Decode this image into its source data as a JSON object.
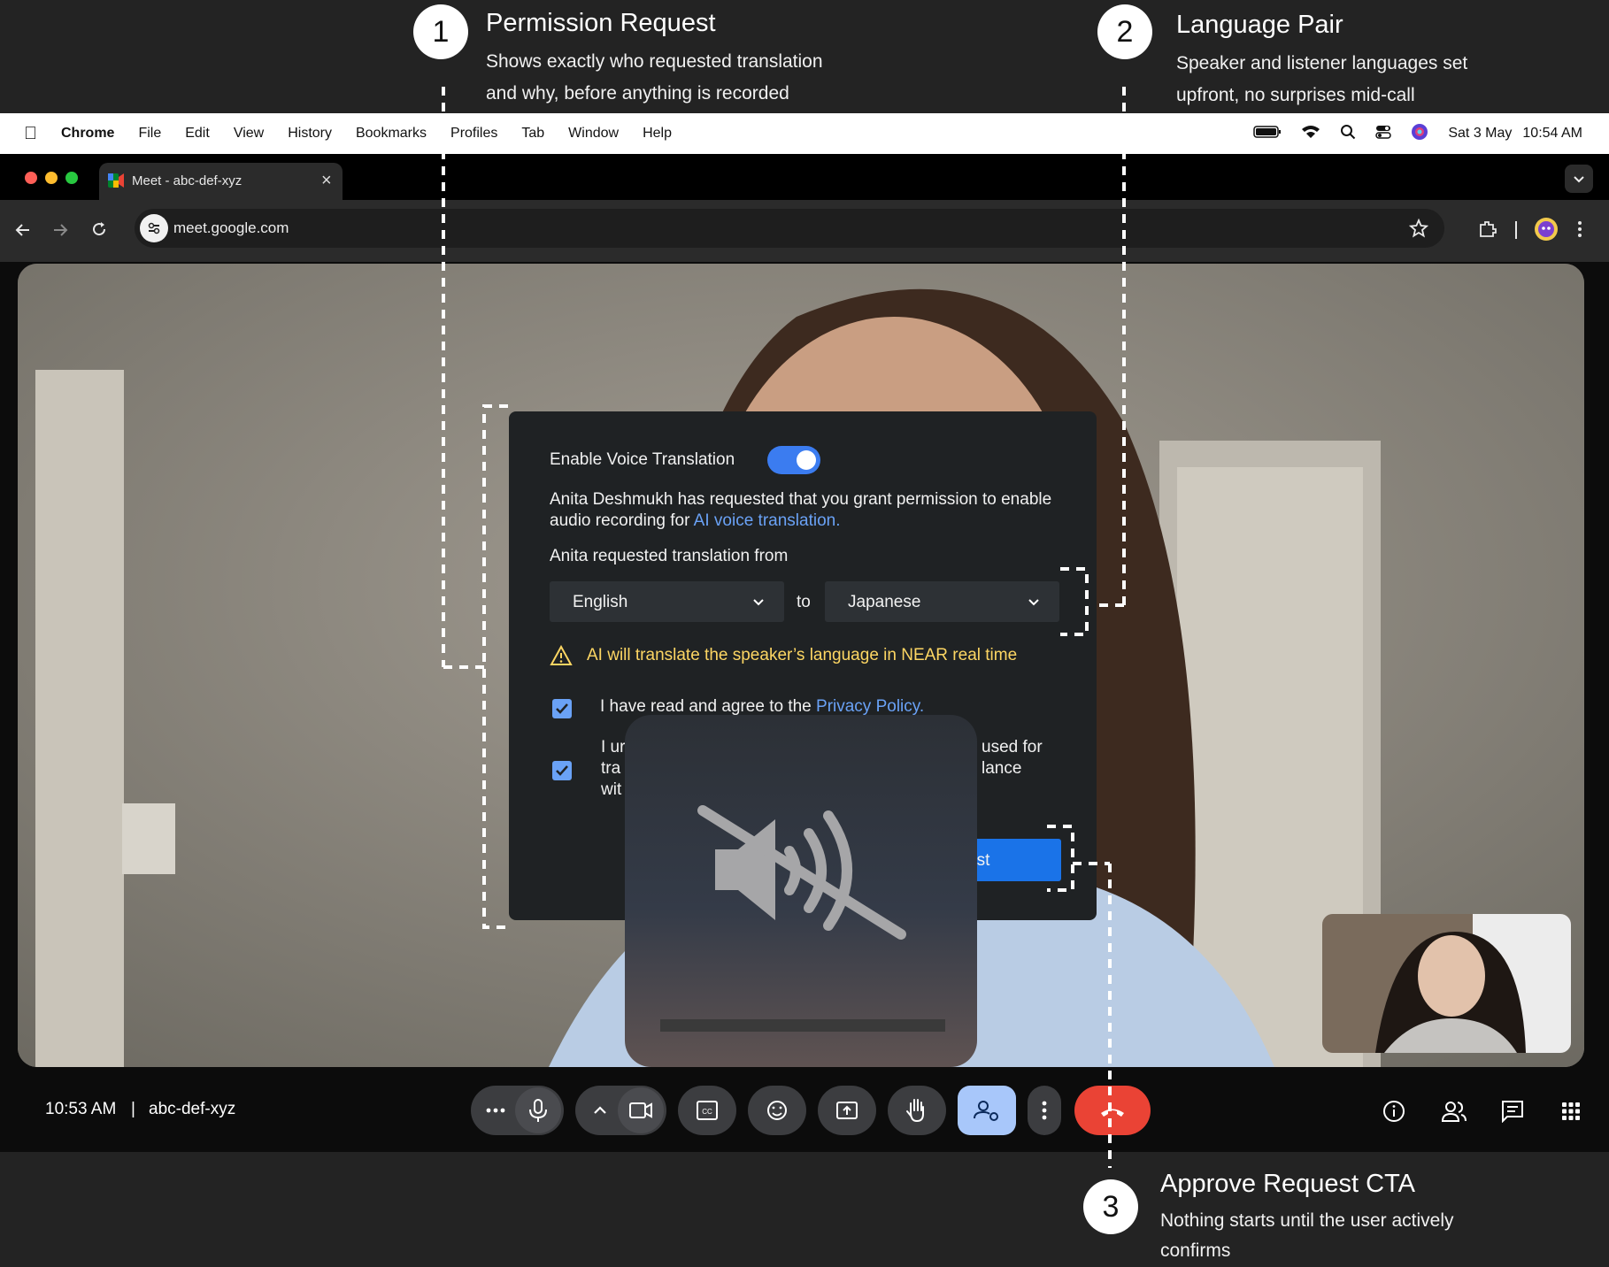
{
  "annotations": [
    {
      "number": "1",
      "title": "Permission Request",
      "desc_line1": "Shows exactly who requested translation",
      "desc_line2": "and why, before anything is recorded"
    },
    {
      "number": "2",
      "title": "Language Pair",
      "desc_line1": "Speaker and listener languages set",
      "desc_line2": "upfront, no surprises mid-call"
    },
    {
      "number": "3",
      "title": "Approve Request CTA",
      "desc_line1": "Nothing starts until the user actively",
      "desc_line2": "confirms"
    }
  ],
  "menubar": {
    "app": "Chrome",
    "items": [
      "File",
      "Edit",
      "View",
      "History",
      "Bookmarks",
      "Profiles",
      "Tab",
      "Window",
      "Help"
    ],
    "date": "Sat 3 May",
    "time": "10:54 AM"
  },
  "browser": {
    "tab_title": "Meet - abc-def-xyz",
    "url": "meet.google.com"
  },
  "dialog": {
    "toggle_label": "Enable Voice Translation",
    "toggle_on": true,
    "request_text": "Anita Deshmukh has requested that you grant permission to enable audio recording for",
    "request_link": "AI voice translation.",
    "from_label": "Anita requested translation from",
    "source_language": "English",
    "to_label": "to",
    "target_language": "Japanese",
    "warning": "AI will translate the speaker’s language in NEAR real time",
    "checkbox1_text": "I have read and agree to the",
    "checkbox1_link": "Privacy Policy.",
    "checkbox2_line1_left": "I ur",
    "checkbox2_line1_right": "used for",
    "checkbox2_line2_left": "tra",
    "checkbox2_line2_right": "lance",
    "checkbox2_line3_left": "wit",
    "approve_fragment": "est"
  },
  "meeting": {
    "time": "10:53 AM",
    "separator": "|",
    "code": "abc-def-xyz"
  },
  "colors": {
    "accent": "#6aa2f6",
    "approve_button": "#1a73e8",
    "end_call": "#ea4335",
    "warning": "#fdd663",
    "active_control": "#a8c7fa"
  }
}
